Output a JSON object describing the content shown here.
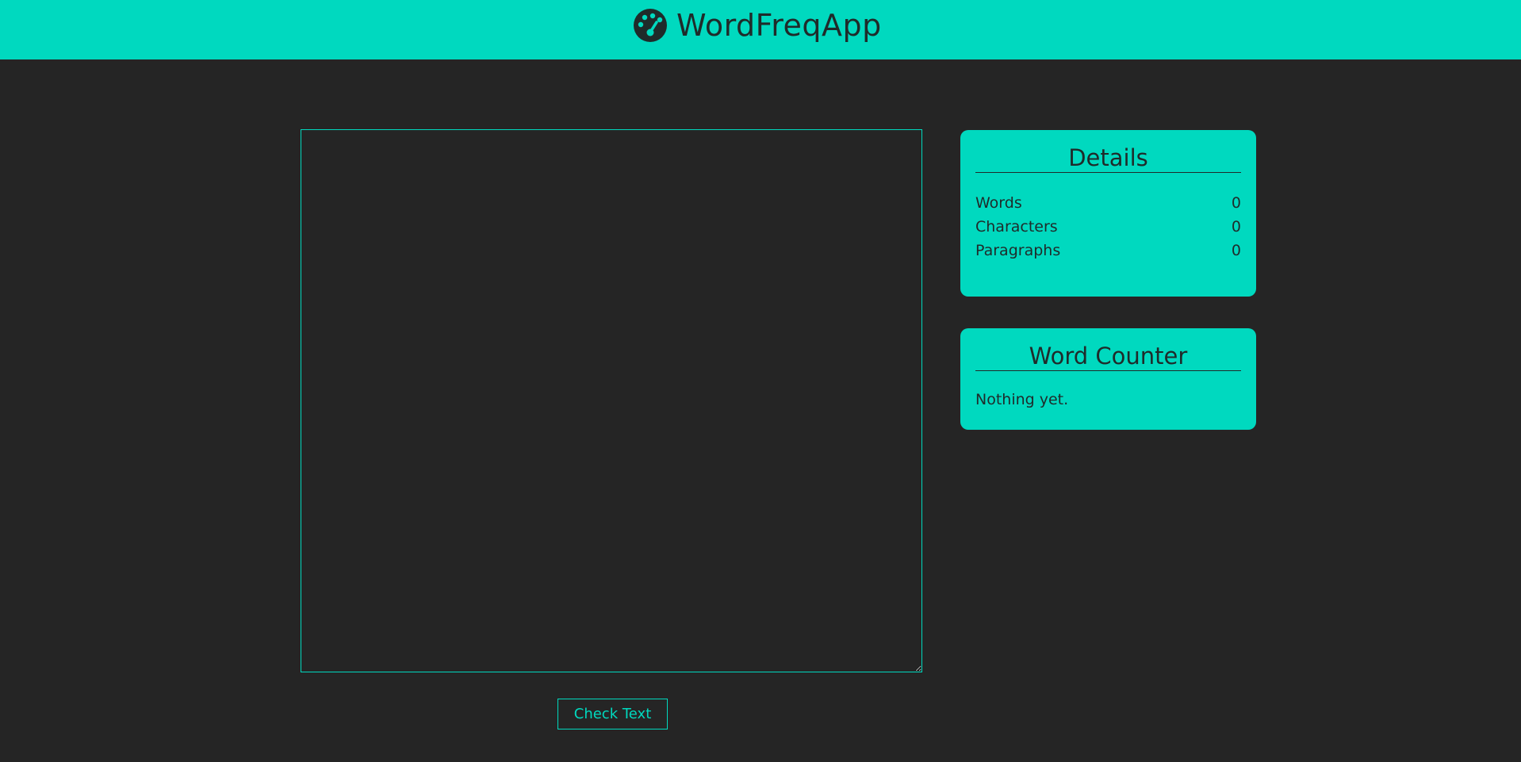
{
  "header": {
    "icon": "palette-icon",
    "title": "WordFreqApp"
  },
  "editor": {
    "value": "",
    "placeholder": ""
  },
  "check_button": {
    "label": "Check Text"
  },
  "details": {
    "title": "Details",
    "stats": [
      {
        "label": "Words",
        "value": "0"
      },
      {
        "label": "Characters",
        "value": "0"
      },
      {
        "label": "Paragraphs",
        "value": "0"
      }
    ]
  },
  "word_counter": {
    "title": "Word Counter",
    "empty_text": "Nothing yet."
  },
  "colors": {
    "accent": "#00d9bf",
    "background": "#252525",
    "dark_text": "#1f2b2a"
  }
}
